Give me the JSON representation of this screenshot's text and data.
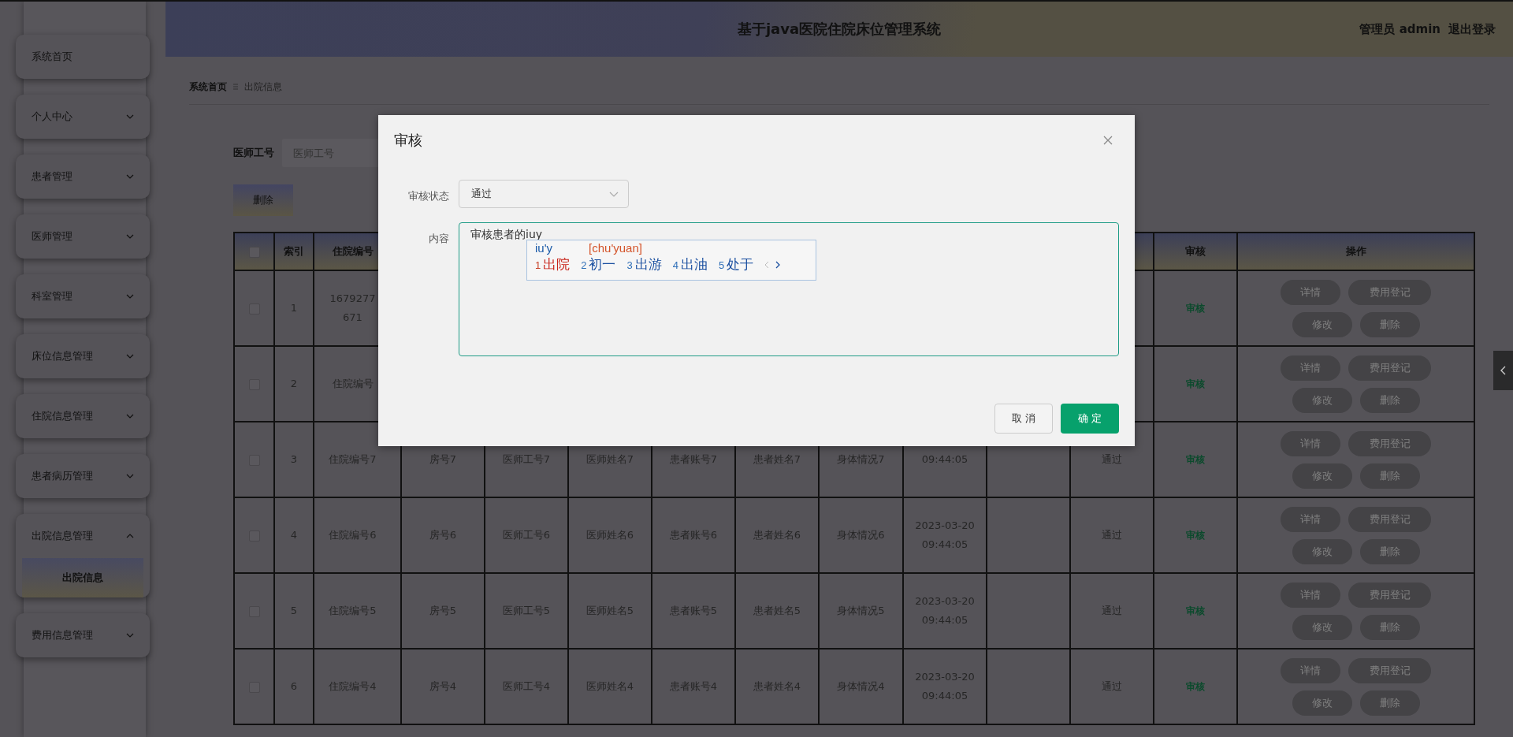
{
  "sidebar": {
    "items": [
      {
        "label": "系统首页",
        "kind": "link"
      },
      {
        "label": "个人中心",
        "kind": "menu",
        "expanded": false
      },
      {
        "label": "患者管理",
        "kind": "menu",
        "expanded": false
      },
      {
        "label": "医师管理",
        "kind": "menu",
        "expanded": false
      },
      {
        "label": "科室管理",
        "kind": "menu",
        "expanded": false
      },
      {
        "label": "床位信息管理",
        "kind": "menu",
        "expanded": false
      },
      {
        "label": "住院信息管理",
        "kind": "menu",
        "expanded": false
      },
      {
        "label": "患者病历管理",
        "kind": "menu",
        "expanded": false
      },
      {
        "label": "出院信息管理",
        "kind": "menu",
        "expanded": true,
        "children": [
          {
            "label": "出院信息",
            "selected": true
          }
        ]
      },
      {
        "label": "费用信息管理",
        "kind": "menu",
        "expanded": false
      }
    ]
  },
  "header": {
    "title": "基于java医院住院床位管理系统",
    "user": "管理员 admin",
    "logout": "退出登录"
  },
  "breadcrumb": [
    "系统首页",
    "出院信息"
  ],
  "search": {
    "label": "医师工号",
    "placeholder": "医师工号"
  },
  "delete_button": "删除",
  "table": {
    "select_all_checked": false,
    "columns": [
      {
        "kind": "text",
        "label": "索引"
      },
      {
        "kind": "text",
        "label": "住院编号"
      },
      {
        "kind": "text"
      },
      {
        "kind": "text"
      },
      {
        "kind": "text"
      },
      {
        "kind": "text"
      },
      {
        "kind": "text"
      },
      {
        "kind": "text"
      },
      {
        "kind": "text"
      },
      {
        "kind": "text"
      },
      {
        "kind": "text"
      },
      {
        "kind": "audit",
        "label": "审核"
      },
      {
        "kind": "actions",
        "label": "操作"
      }
    ],
    "rows": [
      {
        "checked": false,
        "cells": [
          [
            "1"
          ],
          [
            "1679277",
            "671"
          ],
          null,
          null,
          null,
          null,
          null,
          null,
          null,
          null,
          null
        ],
        "audit": "审核",
        "actions": [
          "详情",
          "费用登记",
          "修改",
          "删除"
        ]
      },
      {
        "checked": false,
        "cells": [
          [
            "2"
          ],
          [
            "住院编号"
          ],
          null,
          null,
          null,
          null,
          null,
          null,
          null,
          null,
          null
        ],
        "audit": "审核",
        "actions": [
          "详情",
          "费用登记",
          "修改",
          "删除"
        ]
      },
      {
        "checked": false,
        "cells": [
          [
            "3"
          ],
          [
            "住院编号7"
          ],
          [
            "房号7"
          ],
          [
            "医师工号7"
          ],
          [
            "医师姓名7"
          ],
          [
            "患者账号7"
          ],
          [
            "患者姓名7"
          ],
          [
            "身体情况7"
          ],
          [
            "09:44:05"
          ],
          null,
          [
            "通过"
          ]
        ],
        "audit": "审核",
        "actions": [
          "详情",
          "费用登记",
          "修改",
          "删除"
        ]
      },
      {
        "checked": false,
        "cells": [
          [
            "4"
          ],
          [
            "住院编号6"
          ],
          [
            "房号6"
          ],
          [
            "医师工号6"
          ],
          [
            "医师姓名6"
          ],
          [
            "患者账号6"
          ],
          [
            "患者姓名6"
          ],
          [
            "身体情况6"
          ],
          [
            "2023-03-20",
            "09:44:05"
          ],
          null,
          [
            "通过"
          ]
        ],
        "audit": "审核",
        "actions": [
          "详情",
          "费用登记",
          "修改",
          "删除"
        ]
      },
      {
        "checked": false,
        "cells": [
          [
            "5"
          ],
          [
            "住院编号5"
          ],
          [
            "房号5"
          ],
          [
            "医师工号5"
          ],
          [
            "医师姓名5"
          ],
          [
            "患者账号5"
          ],
          [
            "患者姓名5"
          ],
          [
            "身体情况5"
          ],
          [
            "2023-03-20",
            "09:44:05"
          ],
          null,
          [
            "通过"
          ]
        ],
        "audit": "审核",
        "actions": [
          "详情",
          "费用登记",
          "修改",
          "删除"
        ]
      },
      {
        "checked": false,
        "cells": [
          [
            "6"
          ],
          [
            "住院编号4"
          ],
          [
            "房号4"
          ],
          [
            "医师工号4"
          ],
          [
            "医师姓名4"
          ],
          [
            "患者账号4"
          ],
          [
            "患者姓名4"
          ],
          [
            "身体情况4"
          ],
          [
            "2023-03-20",
            "09:44:05"
          ],
          null,
          [
            "通过"
          ]
        ],
        "audit": "审核",
        "actions": [
          "详情",
          "费用登记",
          "修改",
          "删除"
        ]
      }
    ]
  },
  "dialog": {
    "title": "审核",
    "status_label": "审核状态",
    "status_value": "通过",
    "content_label": "内容",
    "content_value": "审核患者的iuy",
    "cancel": "取 消",
    "confirm": "确 定"
  },
  "ime": {
    "composition": "iu'y",
    "pinyin": "[chu'yuan]",
    "candidates": [
      {
        "number": "1",
        "text": "出院",
        "selected": true
      },
      {
        "number": "2",
        "text": "初一",
        "selected": false
      },
      {
        "number": "3",
        "text": "出游",
        "selected": false
      },
      {
        "number": "4",
        "text": "出油",
        "selected": false
      },
      {
        "number": "5",
        "text": "处于",
        "selected": false
      }
    ]
  }
}
